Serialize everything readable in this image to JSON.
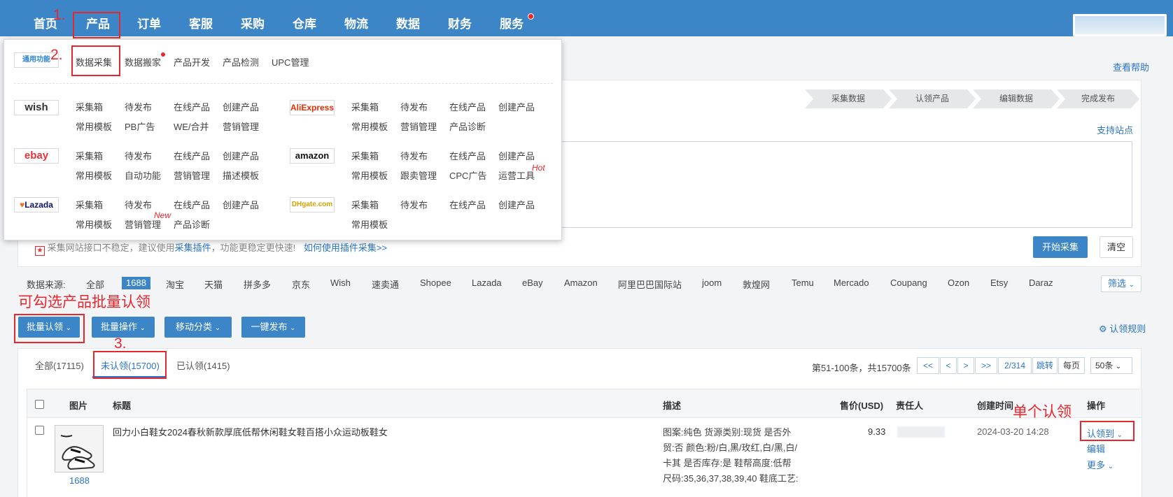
{
  "nav": {
    "items": [
      "首页",
      "产品",
      "订单",
      "客服",
      "采购",
      "仓库",
      "物流",
      "数据",
      "财务",
      "服务"
    ]
  },
  "annotations": {
    "a1": "1.",
    "a2": "2.",
    "a3": "3.",
    "batch_hint": "可勾选产品批量认领",
    "single_hint": "单个认领"
  },
  "help_link": "查看帮助",
  "steps": [
    "采集数据",
    "认领产品",
    "编辑数据",
    "完成发布"
  ],
  "support_sites": "支持站点",
  "notice": {
    "text": "采集网站接口不稳定，建议使用",
    "plugin": "采集插件",
    "text2": "，功能更稳定更快速!",
    "howto": "如何使用插件采集>>"
  },
  "collect_buttons": {
    "start": "开始采集",
    "clear": "清空"
  },
  "sources": {
    "label": "数据来源:",
    "items": [
      "全部",
      "1688",
      "淘宝",
      "天猫",
      "拼多多",
      "京东",
      "Wish",
      "速卖通",
      "Shopee",
      "Lazada",
      "eBay",
      "Amazon",
      "阿里巴巴国际站",
      "joom",
      "敦煌网",
      "Temu",
      "Mercado",
      "Coupang",
      "Ozon",
      "Etsy",
      "Daraz"
    ],
    "filter": "筛选"
  },
  "actions": {
    "batch_claim": "批量认领",
    "batch_ops": "批量操作",
    "move_cat": "移动分类",
    "publish": "一键发布",
    "rules": "认领规则"
  },
  "tabs": {
    "all": "全部(17115)",
    "unclaimed": "未认领(15700)",
    "claimed": "已认领(1415)"
  },
  "pagination": {
    "summary": "第51-100条，共15700条",
    "first": "<<",
    "prev": "<",
    "next": ">",
    "last": ">>",
    "page": "2/314",
    "jump": "跳转",
    "per_page_label": "每页",
    "per_page": "50条"
  },
  "table": {
    "headers": {
      "image": "图片",
      "title": "标题",
      "desc": "描述",
      "price": "售价(USD)",
      "owner": "责任人",
      "created": "创建时间",
      "op": "操作"
    },
    "rows": [
      {
        "source": "1688",
        "title": "回力小白鞋女2024春秋新款厚底低帮休闲鞋女鞋百搭小众运动板鞋女",
        "desc": [
          "图案:纯色 货源类别:现货 是否外",
          "贸:否 颜色:粉/白,黑/玫红,白/黑,白/",
          "卡其 是否库存:是 鞋帮高度:低帮",
          "尺码:35,36,37,38,39,40 鞋底工艺:"
        ],
        "price": "9.33",
        "created": "2024-03-20 14:28",
        "ops": {
          "claim": "认领到",
          "edit": "编辑",
          "more": "更多"
        }
      }
    ]
  },
  "dropdown": {
    "general_logo": "通用功能",
    "general": [
      "数据采集",
      "数据搬家",
      "产品开发",
      "产品检测",
      "UPC管理"
    ],
    "platforms": [
      {
        "logo": "wish",
        "row1": [
          "采集箱",
          "待发布",
          "在线产品",
          "创建产品"
        ],
        "row2": [
          "常用模板",
          "PB广告",
          "WE/合并",
          "营销管理"
        ]
      },
      {
        "logo": "AliExpress",
        "row1": [
          "采集箱",
          "待发布",
          "在线产品",
          "创建产品"
        ],
        "row2": [
          "常用模板",
          "营销管理",
          "产品诊断"
        ]
      },
      {
        "logo": "ebay",
        "row1": [
          "采集箱",
          "待发布",
          "在线产品",
          "创建产品"
        ],
        "row2": [
          "常用模板",
          "自动功能",
          "营销管理",
          "描述模板"
        ]
      },
      {
        "logo": "amazon",
        "row1": [
          "采集箱",
          "待发布",
          "在线产品",
          "创建产品"
        ],
        "row2": [
          "常用模板",
          "跟卖管理",
          "CPC广告",
          "运营工具"
        ]
      },
      {
        "logo": "Lazada",
        "row1": [
          "采集箱",
          "待发布",
          "在线产品",
          "创建产品"
        ],
        "row2": [
          "常用模板",
          "营销管理",
          "产品诊断"
        ]
      },
      {
        "logo": "DHgate.com",
        "row1": [
          "采集箱",
          "待发布",
          "在线产品",
          "创建产品"
        ],
        "row2": [
          "常用模板"
        ]
      }
    ],
    "hot": "Hot",
    "new": "New"
  },
  "colors": {
    "primary": "#3c86c7",
    "annotation": "#e8262d",
    "link": "#2b74c7"
  }
}
